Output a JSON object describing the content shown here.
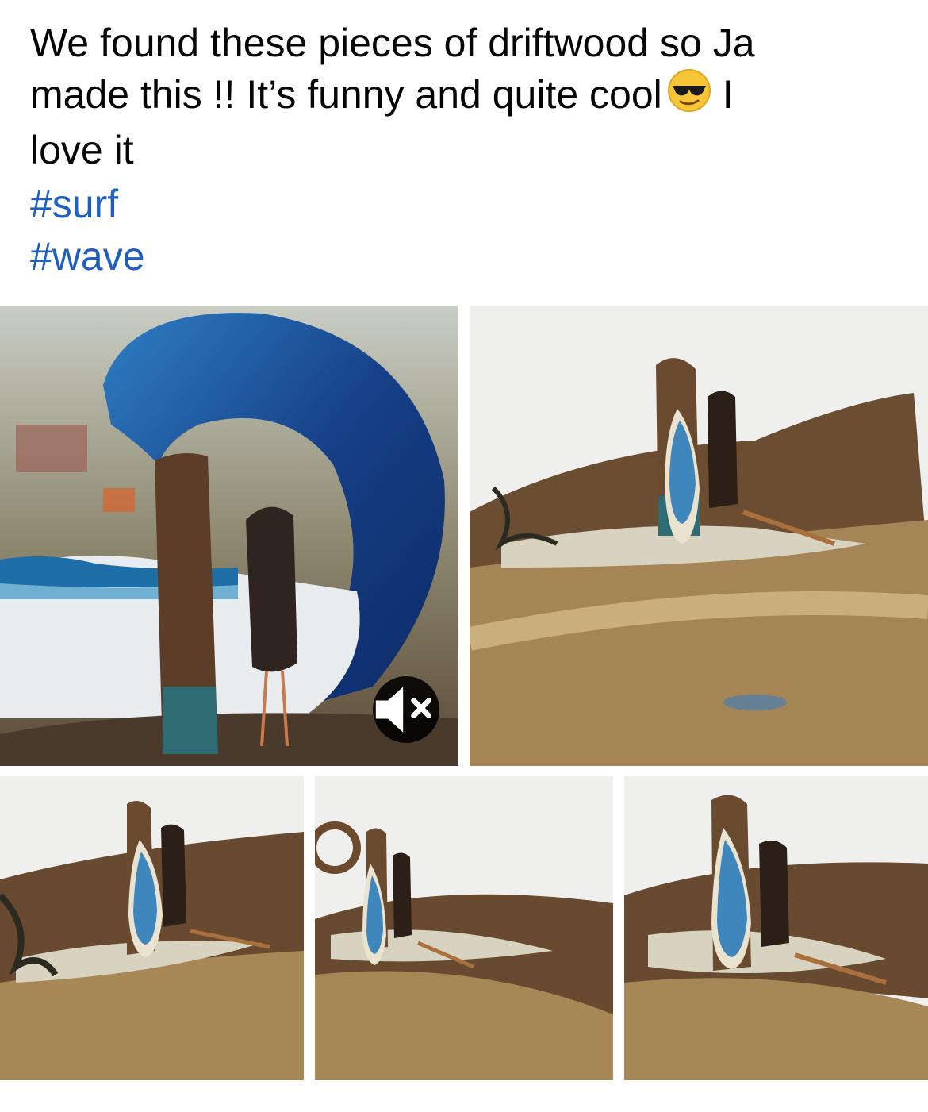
{
  "post": {
    "text_line1": "We found these pieces of driftwood so Ja",
    "text_line2_before_emoji": "made this !!  It’s funny and quite cool",
    "emoji": "smiling-face-with-sunglasses",
    "text_line2_after_emoji": "I",
    "text_line3": "love it",
    "hashtags": [
      "#surf",
      "#wave"
    ]
  },
  "media": {
    "photos": [
      {
        "subject": "resin wave art with driftwood surfer figures",
        "has_video_control": true
      },
      {
        "subject": "driftwood surfer scene with surfboard and fish skeleton"
      },
      {
        "subject": "driftwood surfer scene"
      },
      {
        "subject": "driftwood surfer scene with wreath"
      },
      {
        "subject": "driftwood surfer scene close-up"
      }
    ],
    "mute_icon": "speaker-muted-icon"
  },
  "colors": {
    "text": "#050505",
    "hashtag": "#1f5fbf",
    "wave_blue": "#1d6fb5",
    "driftwood": "#7a5a3c"
  }
}
